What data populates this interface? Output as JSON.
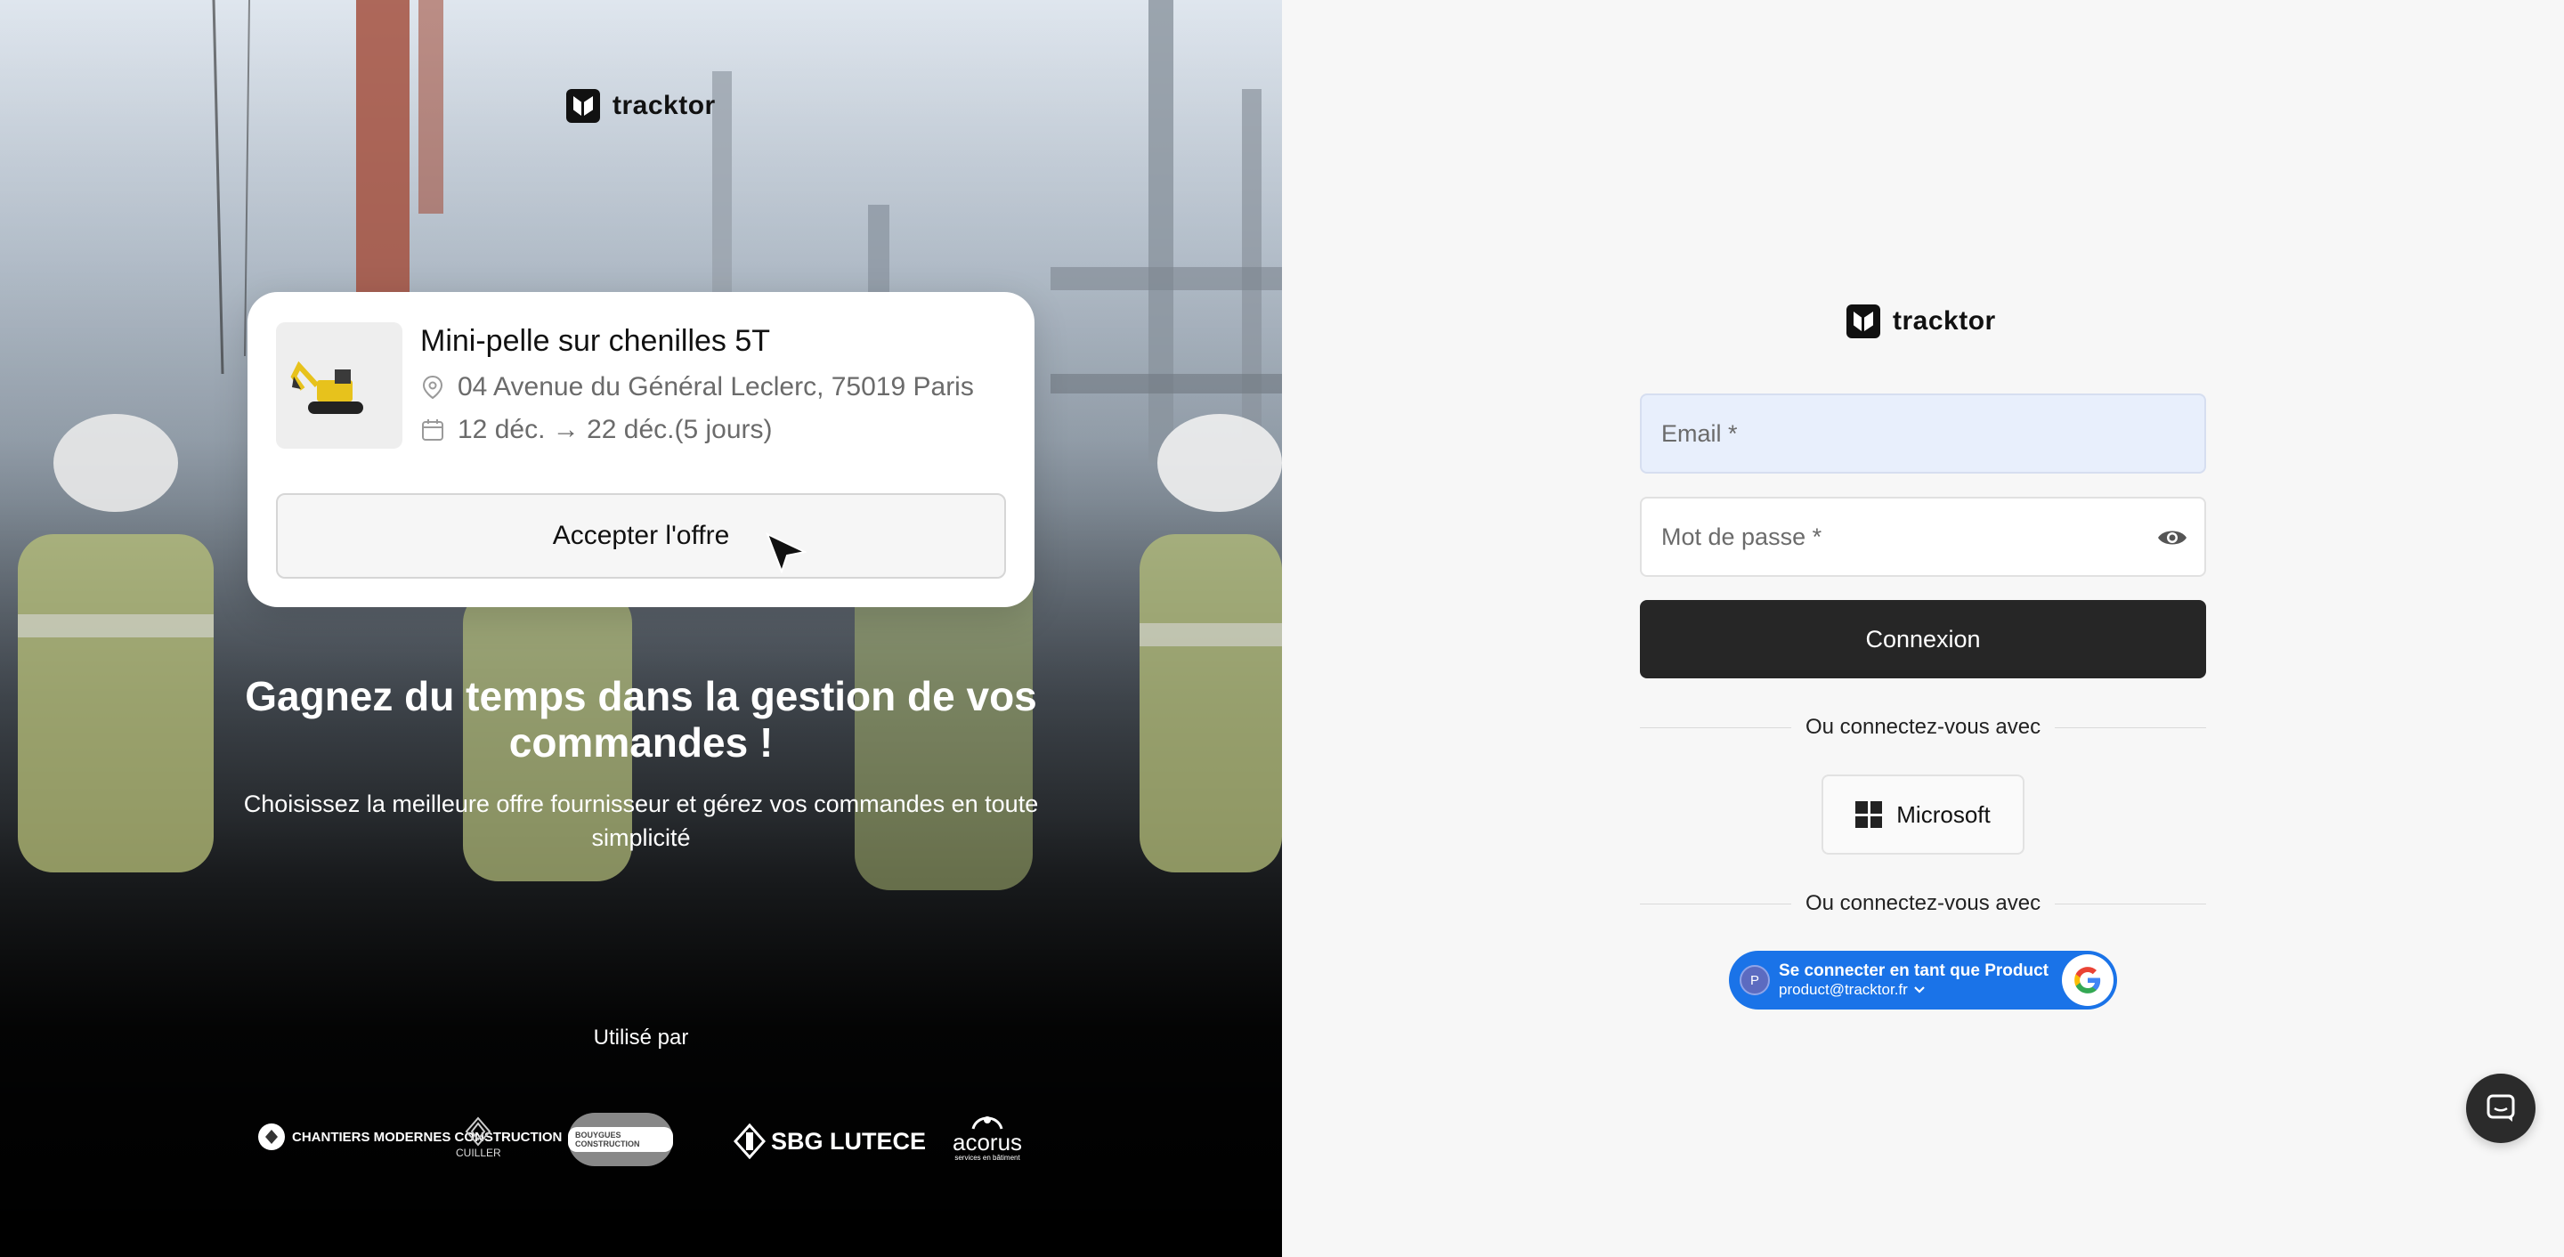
{
  "brand": {
    "name": "tracktor"
  },
  "offer": {
    "title": "Mini-pelle sur chenilles 5T",
    "address": "04 Avenue du Général Leclerc, 75019 Paris",
    "dates": "12 déc. → 22  déc.(5 jours)",
    "accept_label": "Accepter l'offre"
  },
  "hero": {
    "headline": "Gagnez du temps dans la gestion de vos commandes !",
    "subline": "Choisissez la meilleure offre fournisseur et gérez vos commandes en toute simplicité",
    "used_by": "Utilisé par"
  },
  "partners": [
    {
      "name": "CHANTIERS MODERNES CONSTRUCTION"
    },
    {
      "name": "CUILLER"
    },
    {
      "name": "BOUYGUES CONSTRUCTION"
    },
    {
      "name": "SBG LUTECE"
    },
    {
      "name": "acorus",
      "tagline": "services en bâtiment"
    }
  ],
  "login": {
    "email_placeholder": "Email *",
    "password_placeholder": "Mot de passe *",
    "submit_label": "Connexion",
    "divider_label": "Ou connectez-vous avec",
    "microsoft_label": "Microsoft",
    "google": {
      "avatar_initial": "P",
      "title": "Se connecter en tant que Product",
      "email": "product@tracktor.fr"
    }
  },
  "colors": {
    "primary_button": "#262626",
    "email_field_bg": "#e8effc",
    "google_blue": "#1a73e8",
    "panel_bg": "#f7f7f7"
  },
  "icons": {
    "brand": "tracktor-logo-icon",
    "location": "location-pin-icon",
    "calendar": "calendar-icon",
    "eye": "eye-icon",
    "microsoft": "microsoft-icon",
    "google": "google-icon",
    "chat": "chat-icon",
    "chevron": "chevron-down-icon"
  }
}
